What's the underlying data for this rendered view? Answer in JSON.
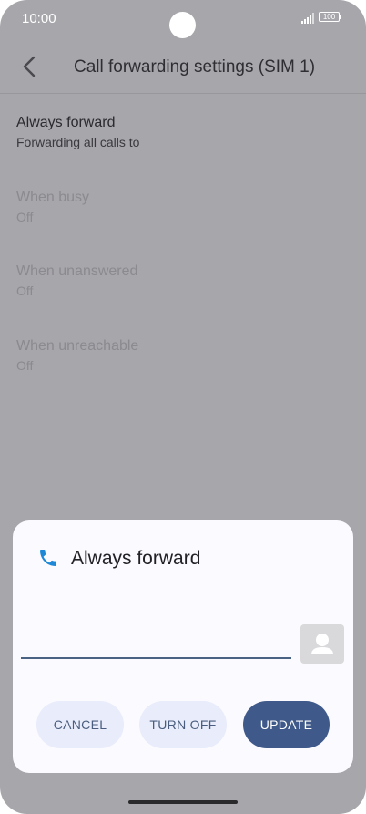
{
  "status_bar": {
    "time": "10:00",
    "battery": "100"
  },
  "app_bar": {
    "title": "Call forwarding settings (SIM 1)"
  },
  "settings": [
    {
      "title": "Always forward",
      "subtitle": "Forwarding all calls to",
      "enabled": true
    },
    {
      "title": "When busy",
      "subtitle": "Off",
      "enabled": false
    },
    {
      "title": "When unanswered",
      "subtitle": "Off",
      "enabled": false
    },
    {
      "title": "When unreachable",
      "subtitle": "Off",
      "enabled": false
    }
  ],
  "dialog": {
    "title": "Always forward",
    "number_value": "",
    "buttons": {
      "cancel": "CANCEL",
      "turn_off": "TURN OFF",
      "update": "UPDATE"
    }
  },
  "colors": {
    "accent": "#3f5a8a",
    "phone_icon": "#1e88d6",
    "scrim": "#a7a6ab"
  },
  "icons": {
    "back": "back-arrow-icon",
    "phone": "phone-icon",
    "contact": "contact-icon"
  }
}
